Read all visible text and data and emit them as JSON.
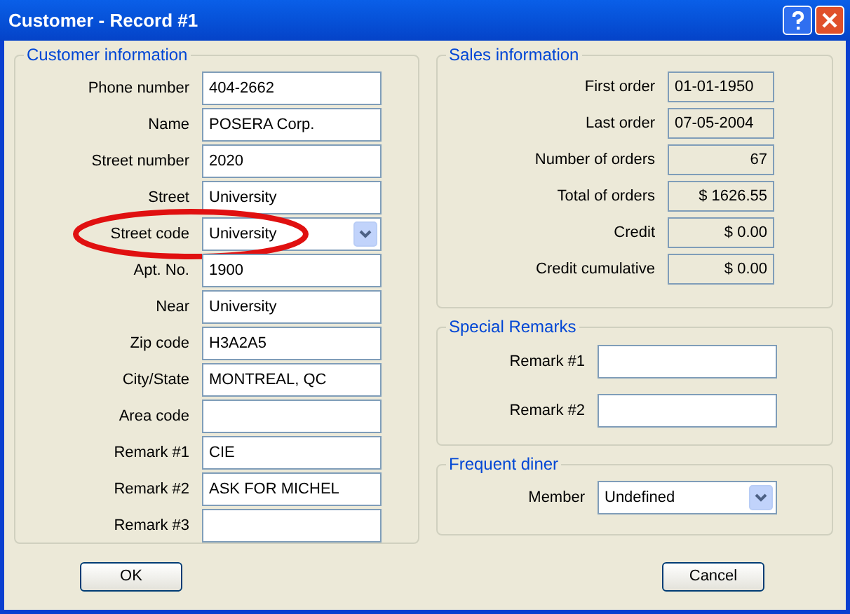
{
  "window": {
    "title": "Customer - Record #1"
  },
  "customer_information": {
    "title": "Customer information",
    "fields": [
      {
        "label": "Phone number",
        "kind": "text",
        "value": "404-2662",
        "circled": false
      },
      {
        "label": "Name",
        "kind": "text",
        "value": "POSERA Corp.",
        "circled": false
      },
      {
        "label": "Street number",
        "kind": "text",
        "value": "2020",
        "circled": false
      },
      {
        "label": "Street",
        "kind": "text",
        "value": "University",
        "circled": false
      },
      {
        "label": "Street code",
        "kind": "select",
        "value": "University",
        "circled": true
      },
      {
        "label": "Apt. No.",
        "kind": "text",
        "value": "1900",
        "circled": false
      },
      {
        "label": "Near",
        "kind": "text",
        "value": "University",
        "circled": false
      },
      {
        "label": "Zip code",
        "kind": "text",
        "value": "H3A2A5",
        "circled": false
      },
      {
        "label": "City/State",
        "kind": "text",
        "value": "MONTREAL, QC",
        "circled": false
      },
      {
        "label": "Area code",
        "kind": "text",
        "circled": false
      },
      {
        "label": "Remark #1",
        "kind": "text",
        "value": "CIE",
        "circled": false
      },
      {
        "label": "Remark #2",
        "kind": "text",
        "value": "ASK FOR MICHEL",
        "circled": false
      },
      {
        "label": "Remark #3",
        "kind": "text",
        "circled": false
      }
    ]
  },
  "sales_information": {
    "title": "Sales information",
    "fields": [
      {
        "label": "First order",
        "value": "01-01-1950",
        "kind": "date"
      },
      {
        "label": "Last order",
        "value": "07-05-2004",
        "kind": "date"
      },
      {
        "label": "Number of orders",
        "value": "67",
        "kind": "number"
      },
      {
        "label": "Total of orders",
        "value": "$ 1626.55",
        "kind": "number"
      },
      {
        "label": "Credit",
        "value": "$ 0.00",
        "kind": "number"
      },
      {
        "label": "Credit cumulative",
        "value": "$ 0.00",
        "kind": "number"
      }
    ]
  },
  "special_remarks": {
    "title": "Special Remarks",
    "fields": [
      {
        "label": "Remark #1",
        "kind": "text"
      },
      {
        "label": "Remark #2",
        "kind": "text"
      }
    ]
  },
  "frequent_diner": {
    "title": "Frequent diner",
    "fields": [
      {
        "label": "Member",
        "kind": "select",
        "value": "Undefined"
      }
    ]
  },
  "buttons": {
    "ok": "OK",
    "cancel": "Cancel"
  }
}
